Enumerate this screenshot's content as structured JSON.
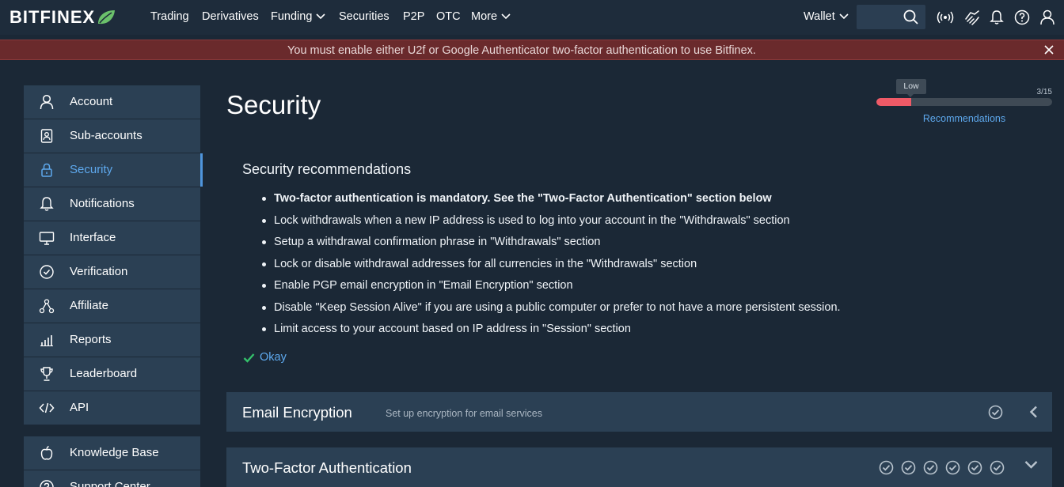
{
  "brand": {
    "logo_text": "BITFINEX",
    "accent": "#6bc16b"
  },
  "nav": {
    "items": [
      {
        "label": "Trading"
      },
      {
        "label": "Derivatives"
      },
      {
        "label": "Funding",
        "has_dropdown": true
      },
      {
        "label": "Securities"
      },
      {
        "label": "P2P"
      },
      {
        "label": "OTC"
      },
      {
        "label": "More",
        "has_dropdown": true
      }
    ],
    "wallet_label": "Wallet",
    "search_placeholder": "",
    "icons": [
      "search-icon",
      "broadcast-icon",
      "handshake-icon",
      "bell-icon",
      "help-icon",
      "user-icon"
    ]
  },
  "alert": {
    "text": "You must enable either U2f or Google Authenticator two-factor authentication to use Bitfinex.",
    "color": "#6a2a2c"
  },
  "sidebar": {
    "items": [
      {
        "label": "Account",
        "icon": "user-icon"
      },
      {
        "label": "Sub-accounts",
        "icon": "contact-card-icon"
      },
      {
        "label": "Security",
        "icon": "lock-icon",
        "active": true
      },
      {
        "label": "Notifications",
        "icon": "bell-icon"
      },
      {
        "label": "Interface",
        "icon": "monitor-icon"
      },
      {
        "label": "Verification",
        "icon": "check-circle-icon"
      },
      {
        "label": "Affiliate",
        "icon": "network-icon"
      },
      {
        "label": "Reports",
        "icon": "bar-chart-icon"
      },
      {
        "label": "Leaderboard",
        "icon": "trophy-icon"
      },
      {
        "label": "API",
        "icon": "code-icon"
      }
    ],
    "secondary": [
      {
        "label": "Knowledge Base",
        "icon": "apple-icon"
      },
      {
        "label": "Support Center",
        "icon": "help-circle-icon"
      }
    ]
  },
  "main": {
    "title": "Security",
    "score": {
      "level": "Low",
      "count_text": "3/15",
      "value": 3,
      "max": 15,
      "link": "Recommendations",
      "fill_color": "#ef5a67"
    },
    "recommendations": {
      "title": "Security recommendations",
      "items": [
        {
          "text": "Two-factor authentication is mandatory. See the \"Two-Factor Authentication\" section below",
          "bold": true
        },
        {
          "text": "Lock withdrawals when a new IP address is used to log into your account in the \"Withdrawals\" section"
        },
        {
          "text": "Setup a withdrawal confirmation phrase in \"Withdrawals\" section"
        },
        {
          "text": "Lock or disable withdrawal addresses for all currencies in the \"Withdrawals\" section"
        },
        {
          "text": "Enable PGP email encryption in \"Email Encryption\" section"
        },
        {
          "text": "Disable \"Keep Session Alive\" if you are using a public computer or prefer to not have a more persistent session."
        },
        {
          "text": "Limit access to your account based on IP address in \"Session\" section"
        }
      ],
      "okay_label": "Okay"
    },
    "panels": [
      {
        "title": "Email Encryption",
        "subtitle": "Set up encryption for email services",
        "check_count": 1,
        "chevron": "left"
      },
      {
        "title": "Two-Factor Authentication",
        "subtitle": "",
        "check_count": 6,
        "chevron": "down"
      }
    ]
  }
}
